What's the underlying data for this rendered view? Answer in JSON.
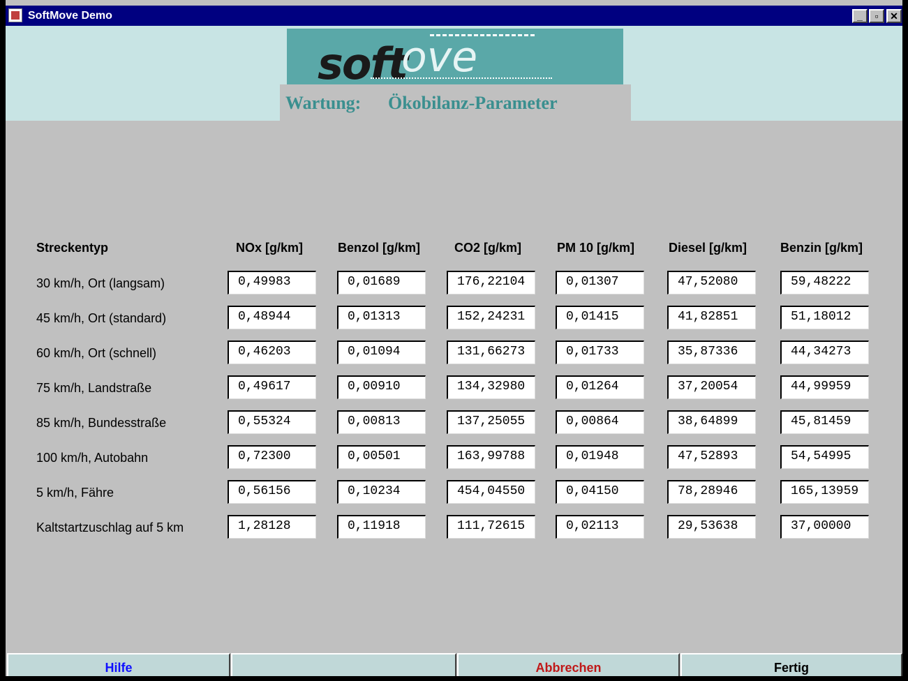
{
  "window": {
    "title": "SoftMove Demo",
    "controls": {
      "minimize": "_",
      "restore": "▫",
      "close": "✕"
    }
  },
  "header": {
    "logo_text_bold": "soft",
    "logo_text_light": "ove",
    "section_label": "Wartung:",
    "page_title": "Ökobilanz-Parameter"
  },
  "table": {
    "row_header": "Streckentyp",
    "columns": [
      "NOx [g/km]",
      "Benzol [g/km]",
      "CO2 [g/km]",
      "PM 10 [g/km]",
      "Diesel [g/km]",
      "Benzin [g/km]"
    ],
    "rows": [
      {
        "label": "30 km/h, Ort (langsam)",
        "values": [
          "0,49983",
          "0,01689",
          "176,22104",
          "0,01307",
          "47,52080",
          "59,48222"
        ]
      },
      {
        "label": "45 km/h, Ort (standard)",
        "values": [
          "0,48944",
          "0,01313",
          "152,24231",
          "0,01415",
          "41,82851",
          "51,18012"
        ]
      },
      {
        "label": "60 km/h, Ort (schnell)",
        "values": [
          "0,46203",
          "0,01094",
          "131,66273",
          "0,01733",
          "35,87336",
          "44,34273"
        ]
      },
      {
        "label": "75 km/h, Landstraße",
        "values": [
          "0,49617",
          "0,00910",
          "134,32980",
          "0,01264",
          "37,20054",
          "44,99959"
        ]
      },
      {
        "label": "85 km/h, Bundesstraße",
        "values": [
          "0,55324",
          "0,00813",
          "137,25055",
          "0,00864",
          "38,64899",
          "45,81459"
        ]
      },
      {
        "label": "100 km/h, Autobahn",
        "values": [
          "0,72300",
          "0,00501",
          "163,99788",
          "0,01948",
          "47,52893",
          "54,54995"
        ]
      },
      {
        "label": "5 km/h, Fähre",
        "values": [
          "0,56156",
          "0,10234",
          "454,04550",
          "0,04150",
          "78,28946",
          "165,13959"
        ]
      },
      {
        "label": "Kaltstartzuschlag auf 5 km",
        "values": [
          "1,28128",
          "0,11918",
          "111,72615",
          "0,02113",
          "29,53638",
          "37,00000"
        ]
      }
    ]
  },
  "footer": {
    "help": "Hilfe",
    "cancel": "Abbrechen",
    "done": "Fertig"
  },
  "colors": {
    "help": "#1010ff",
    "cancel": "#c01818",
    "done": "#000000",
    "title_teal": "#3a8f8f"
  }
}
